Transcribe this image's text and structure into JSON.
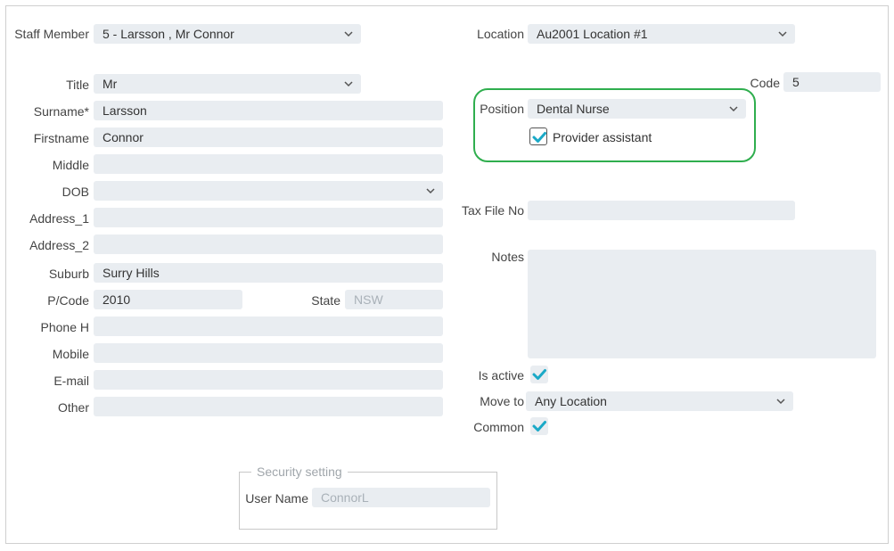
{
  "left": {
    "staff_member": {
      "label": "Staff Member",
      "value": "5 -  Larsson , Mr Connor"
    },
    "title": {
      "label": "Title",
      "value": "Mr"
    },
    "surname": {
      "label": "Surname*",
      "value": "Larsson"
    },
    "firstname": {
      "label": "Firstname",
      "value": "Connor"
    },
    "middle": {
      "label": "Middle",
      "value": ""
    },
    "dob": {
      "label": "DOB",
      "value": ""
    },
    "address1": {
      "label": "Address_1",
      "value": ""
    },
    "address2": {
      "label": "Address_2",
      "value": ""
    },
    "suburb": {
      "label": "Suburb",
      "value": "Surry Hills"
    },
    "pcode": {
      "label": "P/Code",
      "value": "2010"
    },
    "state": {
      "label": "State",
      "value": "NSW"
    },
    "phone_h": {
      "label": "Phone H",
      "value": ""
    },
    "mobile": {
      "label": "Mobile",
      "value": ""
    },
    "email": {
      "label": "E-mail",
      "value": ""
    },
    "other": {
      "label": "Other",
      "value": ""
    }
  },
  "right": {
    "location": {
      "label": "Location",
      "value": "Au2001 Location #1"
    },
    "code": {
      "label": "Code",
      "value": "5"
    },
    "position": {
      "label": "Position",
      "value": "Dental Nurse"
    },
    "provider_assistant": {
      "label": "Provider assistant",
      "checked": true
    },
    "tax_file_no": {
      "label": "Tax File No",
      "value": ""
    },
    "notes": {
      "label": "Notes",
      "value": ""
    },
    "is_active": {
      "label": "Is active",
      "checked": true
    },
    "move_to": {
      "label": "Move to",
      "value": "Any Location"
    },
    "common": {
      "label": "Common",
      "checked": true
    }
  },
  "security": {
    "legend": "Security setting",
    "user_name": {
      "label": "User Name",
      "value": "ConnorL"
    }
  },
  "colors": {
    "highlight": "#2fae4e",
    "check": "#1aa9c7",
    "field_bg": "#e9edf1"
  },
  "icons": {
    "dropdown": "chevron-down-icon",
    "check": "checkmark-icon"
  }
}
